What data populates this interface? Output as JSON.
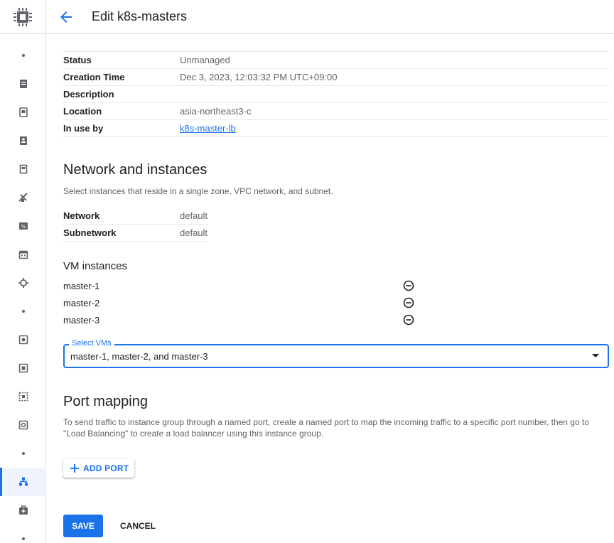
{
  "header": {
    "title": "Edit k8s-masters"
  },
  "rail": {
    "items": [
      {
        "icon": "dot"
      },
      {
        "icon": "instance-icon"
      },
      {
        "icon": "instance-template-icon"
      },
      {
        "icon": "sole-tenant-icon"
      },
      {
        "icon": "machine-image-icon"
      },
      {
        "icon": "tpu-icon"
      },
      {
        "icon": "committed-use-icon"
      },
      {
        "icon": "reservations-icon"
      },
      {
        "icon": "migrate-icon"
      },
      {
        "icon": "dot"
      },
      {
        "icon": "disk-icon"
      },
      {
        "icon": "snapshot-icon"
      },
      {
        "icon": "images-icon"
      },
      {
        "icon": "storage-pool-icon"
      },
      {
        "icon": "dot"
      },
      {
        "icon": "instance-groups-icon",
        "active": true
      },
      {
        "icon": "health-checks-icon"
      },
      {
        "icon": "dot"
      }
    ]
  },
  "details": [
    {
      "key": "Status",
      "value": "Unmanaged"
    },
    {
      "key": "Creation Time",
      "value": "Dec 3, 2023, 12:03:32 PM UTC+09:00"
    },
    {
      "key": "Description",
      "value": ""
    },
    {
      "key": "Location",
      "value": "asia-northeast3-c"
    },
    {
      "key": "In use by",
      "value": "k8s-master-lb",
      "link": true
    }
  ],
  "network_section": {
    "title": "Network and instances",
    "description": "Select instances that reside in a single zone, VPC network, and subnet.",
    "rows": [
      {
        "key": "Network",
        "value": "default"
      },
      {
        "key": "Subnetwork",
        "value": "default"
      }
    ]
  },
  "vm_section": {
    "title": "VM instances",
    "instances": [
      "master-1",
      "master-2",
      "master-3"
    ],
    "select_label": "Select VMs",
    "select_value": "master-1, master-2, and master-3"
  },
  "port_section": {
    "title": "Port mapping",
    "description": "To send traffic to instance group through a named port, create a named port to map the incoming traffic to a specific port number, then go to \"Load Balancing\" to create a load balancer using this instance group.",
    "add_label": "ADD PORT"
  },
  "actions": {
    "save": "SAVE",
    "cancel": "CANCEL"
  },
  "colors": {
    "accent": "#1a73e8",
    "text": "#202124",
    "muted": "#5f6368",
    "divider": "#dadce0"
  }
}
